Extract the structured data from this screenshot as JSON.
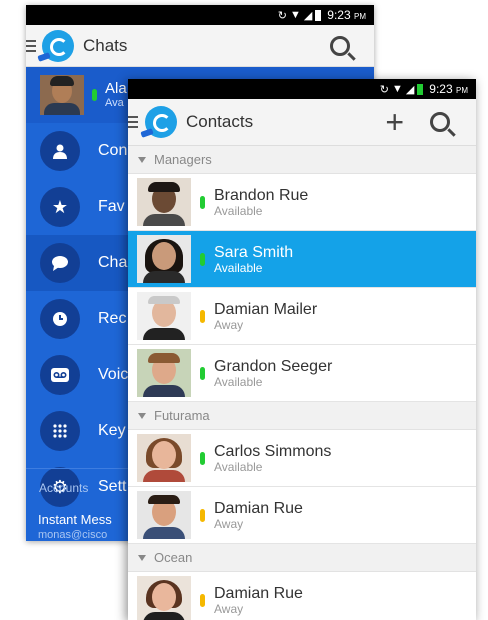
{
  "colors": {
    "blue_drawer": "#1e66d6",
    "selected_row": "#14a2e8",
    "available": "#22cc33",
    "away": "#f5b800"
  },
  "back_screen": {
    "status": {
      "time": "9:23",
      "ampm": "PM"
    },
    "title": "Chats",
    "profile": {
      "name": "Ala",
      "status": "Ava"
    },
    "nav": [
      {
        "label": "Con",
        "icon": "person-icon"
      },
      {
        "label": "Fav",
        "icon": "star-icon"
      },
      {
        "label": "Cha",
        "icon": "chat-icon"
      },
      {
        "label": "Rec",
        "icon": "clock-icon"
      },
      {
        "label": "Voic",
        "icon": "voicemail-icon"
      },
      {
        "label": "Key",
        "icon": "keypad-icon"
      },
      {
        "label": "Sett",
        "icon": "gear-icon"
      }
    ],
    "accounts_header": "Accounts",
    "account": {
      "name": "Instant Mess",
      "email": "monas@cisco"
    }
  },
  "front_screen": {
    "status": {
      "time": "9:23",
      "ampm": "PM"
    },
    "title": "Contacts",
    "groups": [
      {
        "name": "Managers",
        "contacts": [
          {
            "name": "Brandon Rue",
            "status": "Available"
          },
          {
            "name": "Sara Smith",
            "status": "Available"
          },
          {
            "name": "Damian Mailer",
            "status": "Away"
          },
          {
            "name": "Grandon Seeger",
            "status": "Available"
          }
        ]
      },
      {
        "name": "Futurama",
        "contacts": [
          {
            "name": "Carlos Simmons",
            "status": "Available"
          },
          {
            "name": "Damian Rue",
            "status": "Away"
          }
        ]
      },
      {
        "name": "Ocean",
        "contacts": [
          {
            "name": "Damian Rue",
            "status": "Away"
          }
        ]
      }
    ]
  }
}
